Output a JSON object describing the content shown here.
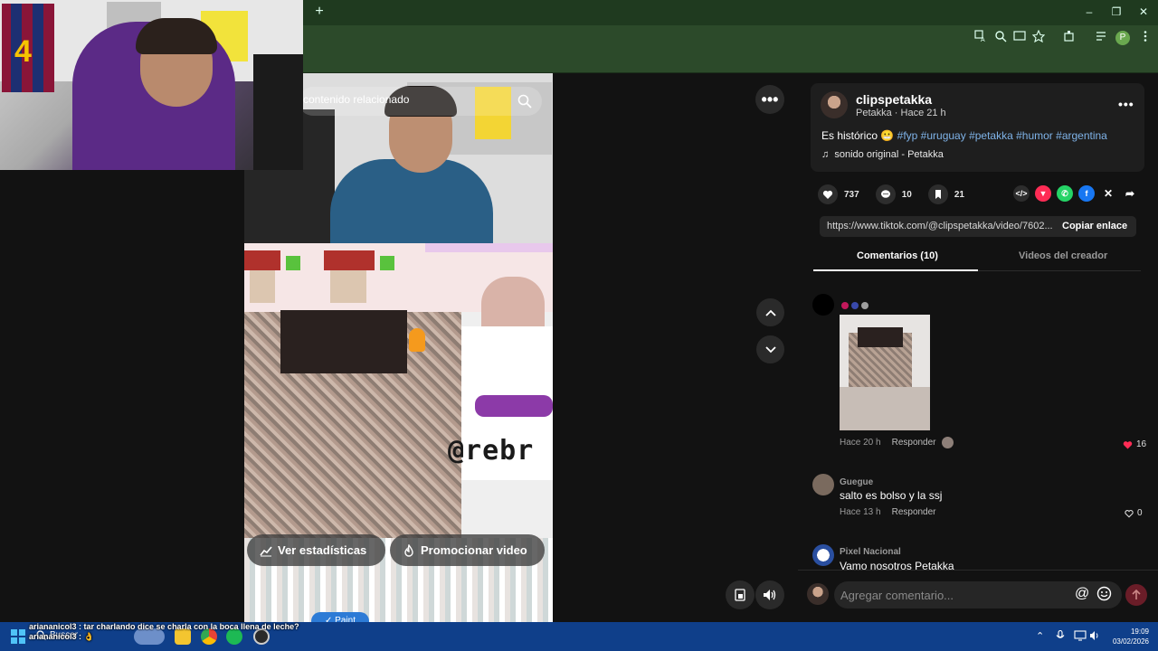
{
  "browser": {
    "new_tab": "+",
    "window_controls": [
      "–",
      "❐",
      "✕"
    ],
    "profile_initial": "P",
    "icons": [
      "translate-icon",
      "zoom-icon",
      "cast-icon",
      "bookmark-star-icon",
      "extensions-icon",
      "reading-list-icon",
      "profile-icon",
      "menu-icon"
    ]
  },
  "video": {
    "search_placeholder": "contenido relacionado",
    "pixel_text": "@rebr",
    "stats_button": "Ver estadísticas",
    "promote_button": "Promocionar video",
    "paint_button": "✓ Paint"
  },
  "post": {
    "username": "clipspetakka",
    "subline": "Petakka · Hace 21 h",
    "caption_text": "Es histórico 😬 ",
    "hashtags": [
      "#fyp",
      "#uruguay",
      "#petakka",
      "#humor",
      "#argentina"
    ],
    "sound": "sonido original - Petakka",
    "likes": "737",
    "comments": "10",
    "saves": "21",
    "link": "https://www.tiktok.com/@clipspetakka/video/7602...",
    "copy_link": "Copiar enlace",
    "tabs": [
      "Comentarios (10)",
      "Videos del creador"
    ]
  },
  "comments": [
    {
      "name": "",
      "text": "",
      "time": "Hace 20 h",
      "reply": "Responder",
      "likes": "16",
      "liked": true
    },
    {
      "name": "Guegue",
      "text": "salto es bolso y la ssj",
      "time": "Hace 13 h",
      "reply": "Responder",
      "likes": "0",
      "liked": false
    },
    {
      "name": "Pixel Nacional",
      "text": "Vamo nosotros Petakka"
    }
  ],
  "comment_input": {
    "placeholder": "Agregar comentario..."
  },
  "chat": [
    "ariananicol3 : tar charlando dice se charla con la boca llena de leche?",
    "ariananicol3 : 👌"
  ],
  "taskbar": {
    "search": "Buscar",
    "time": "19:09",
    "date": "03/02/2026"
  },
  "colors": {
    "accent_red": "#fe2c55",
    "hashtag": "#7fb3e8",
    "taskbar": "#0f3f8a",
    "browser": "#2c4a2a"
  }
}
